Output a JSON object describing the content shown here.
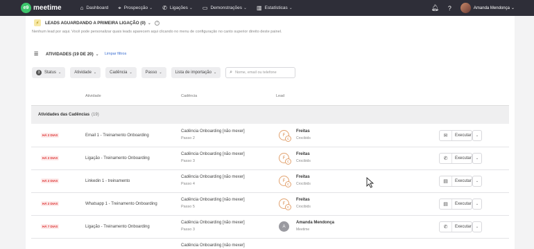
{
  "topbar": {
    "logo_badge": "e9",
    "logo_text": "meetime",
    "nav": [
      {
        "icon": "home-icon",
        "glyph": "⌂",
        "label": "Dashboard",
        "caret": false
      },
      {
        "icon": "crosshair-icon",
        "glyph": "⌖",
        "label": "Prospecção",
        "caret": true
      },
      {
        "icon": "phone-icon",
        "glyph": "✆",
        "label": "Ligações",
        "caret": true
      },
      {
        "icon": "monitor-icon",
        "glyph": "▭",
        "label": "Demonstrações",
        "caret": true
      },
      {
        "icon": "bar-chart-icon",
        "glyph": "▥",
        "label": "Estatísticas",
        "caret": true
      }
    ],
    "user_name": "Amanda Mendonça"
  },
  "leads_section": {
    "title": "LEADS AGUARDANDO A PRIMEIRA LIGAÇÃO (0)",
    "empty_message": "Nenhum lead por aqui. Você pode personalizar quais leads aparecem aqui clicando no menu de configuração no canto superior direito deste painel."
  },
  "activities": {
    "title": "ATIVIDADES (19 DE 20)",
    "clear_filters": "Limpar filtros",
    "filters": [
      "Status",
      "Atividade",
      "Cadência",
      "Passo",
      "Lista de importação"
    ],
    "status_badge": "3",
    "search_placeholder": "Nome, email ou telefone",
    "columns": [
      "Atividade",
      "Cadência",
      "Lead"
    ],
    "group_title": "Atividades das Cadências",
    "group_count": "(19)",
    "execute_label": "Executar",
    "rows": [
      {
        "due": "HÁ 2 DIAS",
        "activity": "Email 1 - Treinamento Onboarding",
        "cadence": "Cadência Onboarding [não mexer]",
        "step": "Passo 2",
        "lead_initial": "F",
        "lead_name": "Freitas",
        "lead_company": "Crocibids",
        "action_icon": "mail-icon",
        "action_glyph": "✉"
      },
      {
        "due": "HÁ 2 DIAS",
        "activity": "Ligação - Treinamento Onboarding",
        "cadence": "Cadência Onboarding [não mexer]",
        "step": "Passo 3",
        "lead_initial": "F",
        "lead_name": "Freitas",
        "lead_company": "Crocibids",
        "action_icon": "phone-icon",
        "action_glyph": "✆"
      },
      {
        "due": "HÁ 2 DIAS",
        "activity": "Linkedin 1 - treinamento",
        "cadence": "Cadência Onboarding [não mexer]",
        "step": "Passo 4",
        "lead_initial": "F",
        "lead_name": "Freitas",
        "lead_company": "Crocibids",
        "action_icon": "chat-icon",
        "action_glyph": "▤"
      },
      {
        "due": "HÁ 2 DIAS",
        "activity": "Whatsapp 1 - Treinamento Onboarding",
        "cadence": "Cadência Onboarding [não mexer]",
        "step": "Passo 5",
        "lead_initial": "F",
        "lead_name": "Freitas",
        "lead_company": "Crocibids",
        "action_icon": "chat-icon",
        "action_glyph": "▤"
      },
      {
        "due": "HÁ 7 DIAS",
        "activity": "Ligação - Treinamento Onboarding",
        "cadence": "Cadência Onboarding [não mexer]",
        "step": "Passo 3",
        "lead_initial": "A",
        "lead_name": "Amanda Mendonça",
        "lead_company": "Meetime",
        "action_icon": "phone-icon",
        "action_glyph": "✆"
      },
      {
        "due": "",
        "activity": "",
        "cadence": "Cadência Onboarding [não mexer]",
        "step": "",
        "lead_initial": "",
        "lead_name": "",
        "lead_company": "",
        "action_icon": "",
        "action_glyph": ""
      }
    ]
  }
}
